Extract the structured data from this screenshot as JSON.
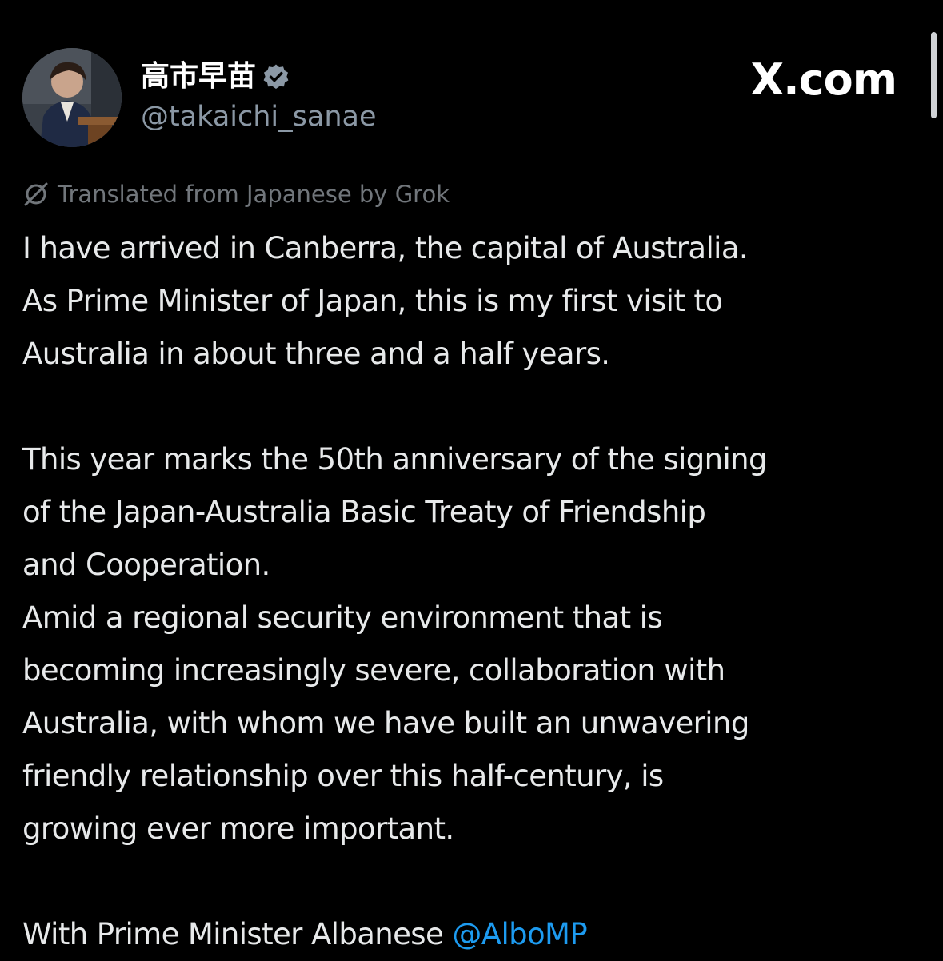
{
  "author": {
    "display_name": "高市早苗",
    "handle": "@takaichi_sanae",
    "verified_icon": "verified-badge-icon",
    "avatar_icon": "profile-photo"
  },
  "site_logo": "X.com",
  "translation_note": "Translated from Japanese by Grok",
  "tweet": {
    "lines": [
      "I have arrived in Canberra, the capital of Australia.",
      "As Prime Minister of Japan, this is my first visit to",
      "Australia in about three and a half years.",
      "",
      "This year marks the 50th anniversary of the signing",
      "of the Japan-Australia Basic Treaty of Friendship",
      "and Cooperation.",
      "Amid a regional security environment that is",
      "becoming increasingly severe, collaboration with",
      "Australia, with whom we have built an unwavering",
      "friendly relationship over this half-century, is",
      "growing ever more important.",
      "",
      "With Prime Minister Albanese"
    ],
    "partial_mention": "@AlboMP"
  },
  "colors": {
    "background": "#000000",
    "text": "#e7e9ea",
    "secondary": "#71767b",
    "mention": "#1d9bf0",
    "verified": "#8b98a5"
  }
}
